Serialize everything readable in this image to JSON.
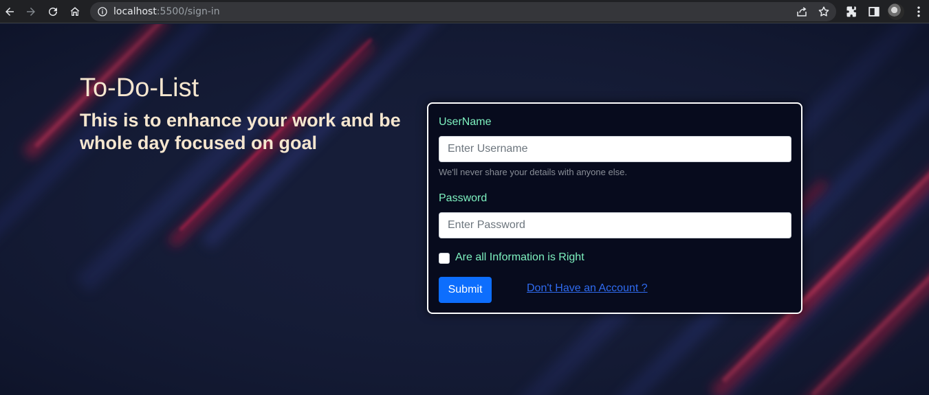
{
  "browser": {
    "url_host": "localhost",
    "url_path": ":5500/sign-in"
  },
  "hero": {
    "title": "To-Do-List",
    "subtitle": "This is to enhance your work and be whole day focused on goal"
  },
  "form": {
    "username_label": "UserName",
    "username_placeholder": "Enter Username",
    "username_help": "We'll never share your details with anyone else.",
    "password_label": "Password",
    "password_placeholder": "Enter Password",
    "checkbox_label": "Are all Information is Right",
    "checkbox_checked": false,
    "submit_label": "Submit",
    "account_link": "Don't Have an Account ?"
  },
  "colors": {
    "accent_label": "#7ef2c0",
    "button": "#0d6efd",
    "link": "#2f6bf0",
    "stripe": "#ff2450",
    "background": "#141b33"
  },
  "icons": [
    "back-icon",
    "forward-icon",
    "reload-icon",
    "home-icon",
    "info-icon",
    "share-icon",
    "star-icon",
    "extensions-icon",
    "side-panel-icon",
    "avatar",
    "menu-icon"
  ]
}
